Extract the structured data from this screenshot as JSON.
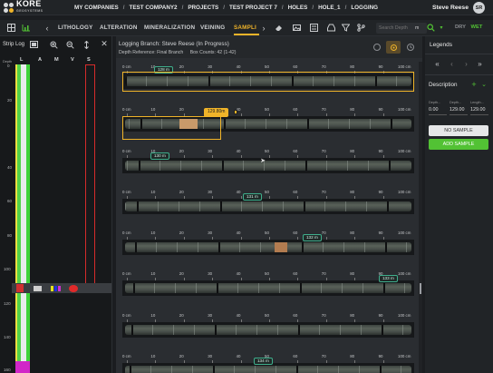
{
  "brand": {
    "name": "KORE",
    "sub": "GEOSYSTEMS"
  },
  "breadcrumbs": [
    "MY COMPANIES",
    "TEST COMPANY2",
    "PROJECTS",
    "TEST PROJECT 7",
    "HOLES",
    "HOLE_1",
    "LOGGING"
  ],
  "user": {
    "name": "Steve Reese",
    "initials": "SR"
  },
  "tabs": [
    "LITHOLOGY",
    "ALTERATION",
    "MINERALIZATION",
    "VEINING",
    "SAMPLI"
  ],
  "active_tab": "SAMPLI",
  "search": {
    "placeholder": "Search Depth",
    "unit": "m"
  },
  "dry_label": "DRY",
  "wet_label": "WET",
  "strip_log": {
    "title": "Strip Log",
    "columns": [
      "L",
      "A",
      "M",
      "V",
      "S"
    ],
    "depth_label": "Depth",
    "depths": [
      "0",
      "20",
      "40",
      "60",
      "80",
      "100",
      "120",
      "140",
      "160"
    ]
  },
  "main": {
    "branch_label": "Logging Branch:",
    "branch_value": "Steve Reese  (In Progress)",
    "depth_ref_label": "Depth Reference:",
    "depth_ref_value": "Final Branch",
    "box_counts_label": "Box Counts:",
    "box_counts_value": "42 (1-42)",
    "ruler_ticks": [
      "0 cm",
      "10",
      "20",
      "30",
      "40",
      "50",
      "60",
      "70",
      "80",
      "90",
      "100 cm"
    ],
    "rows": [
      {
        "tag": "128 m"
      },
      {
        "tag": "",
        "selection_label": "129.80m"
      },
      {
        "tag": "130 m"
      },
      {
        "tag": "131 m"
      },
      {
        "tag": "132 m"
      },
      {
        "tag": "133 m"
      },
      {
        "tag": ""
      },
      {
        "tag": "134 m"
      }
    ]
  },
  "right_panel": {
    "legends_title": "Legends",
    "description_title": "Description",
    "fields": [
      {
        "label": "Depth...",
        "value": "0.00"
      },
      {
        "label": "Depth...",
        "value": "129.00"
      },
      {
        "label": "Length...",
        "value": "129.00"
      }
    ],
    "no_sample_label": "NO SAMPLE",
    "add_sample_label": "ADD SAMPLE"
  },
  "colors": {
    "accent": "#f0b429",
    "green": "#52c234",
    "tag": "#3fae8c",
    "bg": "#1b1d20"
  }
}
